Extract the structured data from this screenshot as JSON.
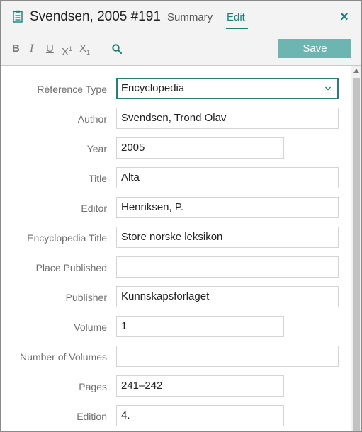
{
  "header": {
    "title": "Svendsen, 2005 #191",
    "tabs": [
      {
        "label": "Summary",
        "active": false
      },
      {
        "label": "Edit",
        "active": true
      }
    ],
    "close_label": "×"
  },
  "toolbar": {
    "bold": "B",
    "italic": "I",
    "underline": "U",
    "superscript_base": "X",
    "superscript_mark": "1",
    "subscript_base": "X",
    "subscript_mark": "1",
    "save_label": "Save"
  },
  "colors": {
    "accent": "#1e7f7a",
    "save_button": "#6db5b0",
    "select_border": "#2c7c77"
  },
  "fields": [
    {
      "label": "Reference Type",
      "value": "Encyclopedia",
      "kind": "select"
    },
    {
      "label": "Author",
      "value": "Svendsen, Trond Olav",
      "kind": "wide"
    },
    {
      "label": "Year",
      "value": "2005",
      "kind": "short"
    },
    {
      "label": "Title",
      "value": "Alta",
      "kind": "wide"
    },
    {
      "label": "Editor",
      "value": "Henriksen, P.",
      "kind": "wide"
    },
    {
      "label": "Encyclopedia Title",
      "value": "Store norske leksikon",
      "kind": "wide"
    },
    {
      "label": "Place Published",
      "value": "",
      "kind": "wide"
    },
    {
      "label": "Publisher",
      "value": "Kunnskapsforlaget",
      "kind": "wide"
    },
    {
      "label": "Volume",
      "value": "1",
      "kind": "short"
    },
    {
      "label": "Number of Volumes",
      "value": "",
      "kind": "wide"
    },
    {
      "label": "Pages",
      "value": "241–242",
      "kind": "short"
    },
    {
      "label": "Edition",
      "value": "4.",
      "kind": "short"
    }
  ]
}
